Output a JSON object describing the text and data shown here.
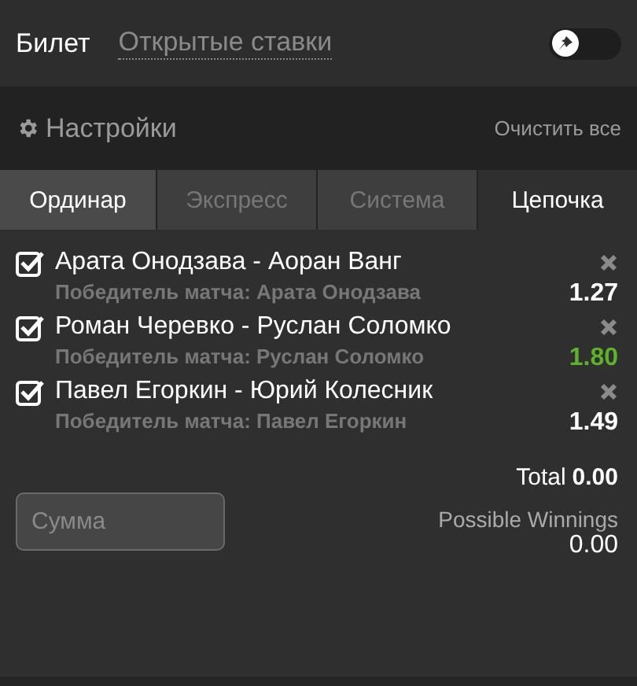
{
  "header": {
    "title": "Билет",
    "link": "Открытые ставки",
    "pin_toggle": {
      "on": false
    }
  },
  "settings": {
    "label": "Настройки",
    "clear": "Очистить все"
  },
  "tabs": [
    {
      "label": "Ординар",
      "selected": false,
      "disabled": false
    },
    {
      "label": "Экспресс",
      "selected": false,
      "disabled": true
    },
    {
      "label": "Система",
      "selected": false,
      "disabled": true
    },
    {
      "label": "Цепочка",
      "selected": true,
      "disabled": false
    }
  ],
  "bets": [
    {
      "match": "Арата Онодзава - Аоран Ванг",
      "checked": true,
      "selection": "Победитель матча: Арата Онодзава",
      "odds": "1.27",
      "odds_changed": false
    },
    {
      "match": "Роман Черевко - Руслан Соломко",
      "checked": true,
      "selection": "Победитель матча: Руслан Соломко",
      "odds": "1.80",
      "odds_changed": true
    },
    {
      "match": "Павел Егоркин - Юрий Колесник",
      "checked": true,
      "selection": "Победитель матча: Павел Егоркин",
      "odds": "1.49",
      "odds_changed": false
    }
  ],
  "footer": {
    "stake": {
      "placeholder": "Сумма"
    },
    "total_label": "Total",
    "total_value": "0.00",
    "winnings_label": "Possible Winnings",
    "winnings_value": "0.00"
  }
}
